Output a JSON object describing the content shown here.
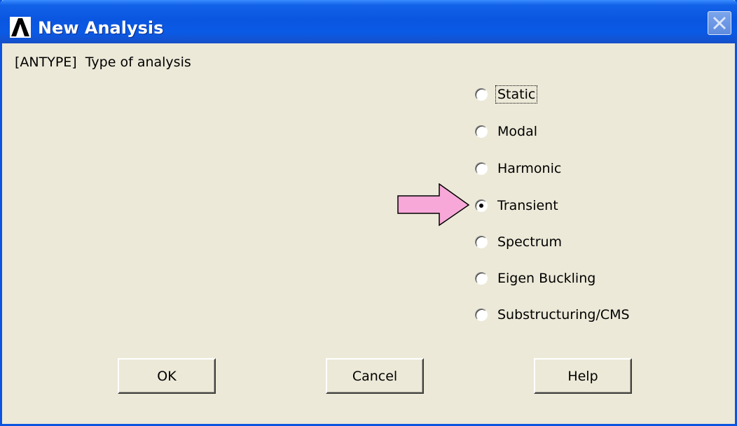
{
  "window": {
    "title": "New Analysis",
    "app_icon": "ansys-logo-icon",
    "close_icon": "close-icon"
  },
  "prompt": {
    "label": "[ANTYPE]  Type of analysis"
  },
  "analysis_types": [
    {
      "label": "Static",
      "selected": false,
      "focused": true
    },
    {
      "label": "Modal",
      "selected": false,
      "focused": false
    },
    {
      "label": "Harmonic",
      "selected": false,
      "focused": false
    },
    {
      "label": "Transient",
      "selected": true,
      "focused": false
    },
    {
      "label": "Spectrum",
      "selected": false,
      "focused": false
    },
    {
      "label": "Eigen Buckling",
      "selected": false,
      "focused": false
    },
    {
      "label": "Substructuring/CMS",
      "selected": false,
      "focused": false
    }
  ],
  "buttons": {
    "ok": "OK",
    "cancel": "Cancel",
    "help": "Help"
  },
  "annotation": {
    "icon": "pointer-arrow-icon",
    "color": "#f7a8d8"
  },
  "colors": {
    "titlebar": "#0a56e0",
    "dialog_bg": "#ece9d8"
  }
}
